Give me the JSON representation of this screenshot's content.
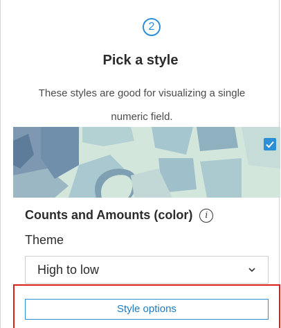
{
  "step": {
    "number": "2"
  },
  "header": {
    "title": "Pick a style",
    "description_line1": "These styles are good for visualizing a single",
    "description_line2": "numeric field."
  },
  "style_card": {
    "selected": true,
    "name": "Counts and Amounts (color)",
    "info_icon": "info-icon"
  },
  "theme": {
    "label": "Theme",
    "selected_value": "High to low"
  },
  "actions": {
    "style_options_label": "Style options"
  },
  "colors": {
    "accent": "#2a8fd6",
    "highlight_border": "#d9211a"
  }
}
